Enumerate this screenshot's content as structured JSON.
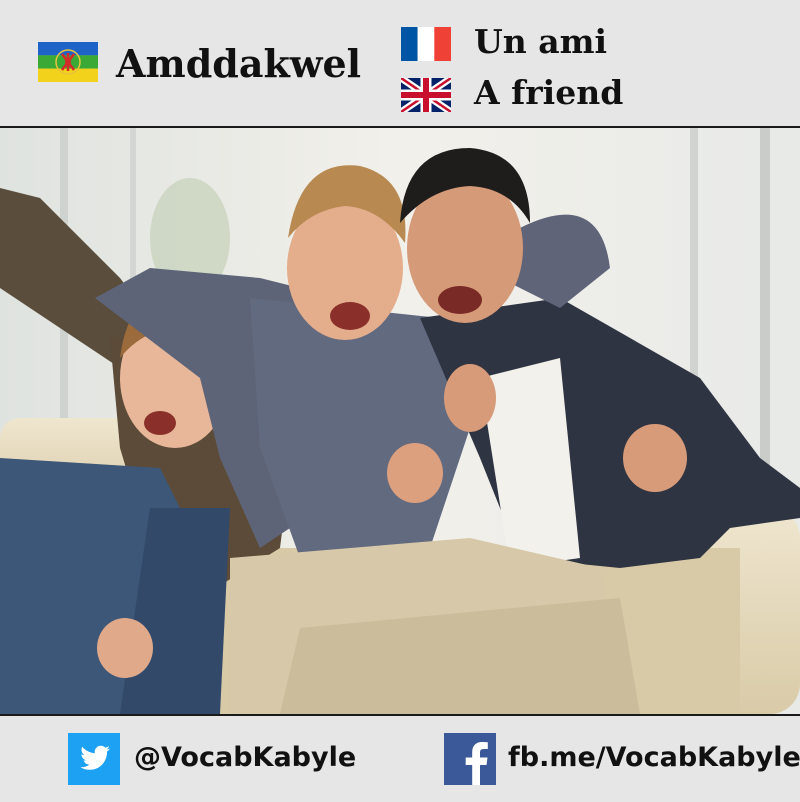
{
  "header": {
    "kabyle_word": "Amddakwel",
    "french_translation": "Un ami",
    "english_translation": "A friend",
    "kabyle_flag_icon": "kabyle-flag-icon",
    "french_flag_icon": "french-flag-icon",
    "uk_flag_icon": "uk-flag-icon"
  },
  "photo": {
    "subject": "three-friends-cheering-on-sofa"
  },
  "footer": {
    "twitter_handle": "@VocabKabyle",
    "facebook_link": "fb.me/VocabKabyle",
    "twitter_icon": "twitter-bird-icon",
    "facebook_icon": "facebook-f-icon"
  },
  "colors": {
    "header_bg": "#e6e6e6",
    "twitter_blue": "#1da1f2",
    "facebook_blue": "#3b5998",
    "french_blue": "#0055a4",
    "french_red": "#ef4135",
    "kabyle_blue": "#1e64c8",
    "kabyle_green": "#3aa935",
    "kabyle_yellow": "#f2d21a"
  }
}
